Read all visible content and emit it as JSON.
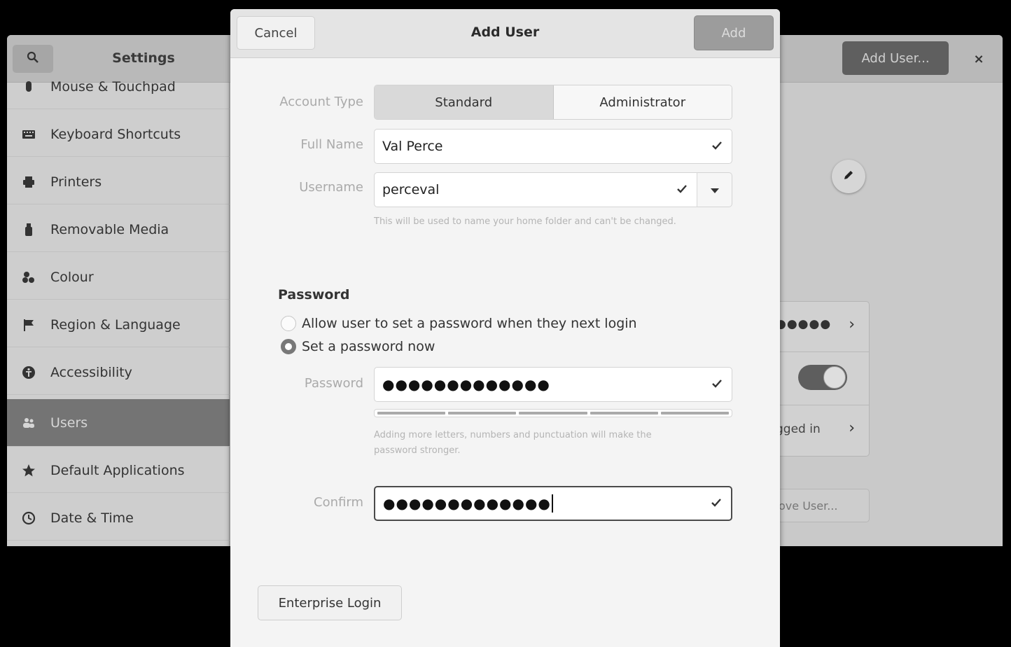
{
  "settings": {
    "title": "Settings",
    "add_user_label": "Add User...",
    "close_label": "×",
    "sidebar": {
      "items": [
        {
          "label": "Mouse & Touchpad",
          "icon": "mouse-icon"
        },
        {
          "label": "Keyboard Shortcuts",
          "icon": "keyboard-icon"
        },
        {
          "label": "Printers",
          "icon": "printer-icon"
        },
        {
          "label": "Removable Media",
          "icon": "usb-icon"
        },
        {
          "label": "Colour",
          "icon": "colour-icon"
        },
        {
          "label": "Region & Language",
          "icon": "flag-icon"
        },
        {
          "label": "Accessibility",
          "icon": "accessibility-icon"
        },
        {
          "label": "Users",
          "icon": "users-icon",
          "active": true
        },
        {
          "label": "Default Applications",
          "icon": "star-icon"
        },
        {
          "label": "Date & Time",
          "icon": "clock-icon"
        }
      ]
    },
    "user_panel": {
      "password_dots": "●●●●●",
      "logged_in_text": "gged in",
      "remove_user_label": "ove User..."
    }
  },
  "dialog": {
    "title": "Add User",
    "cancel_label": "Cancel",
    "add_label": "Add",
    "account_type": {
      "label": "Account Type",
      "options": [
        "Standard",
        "Administrator"
      ],
      "selected": "Standard"
    },
    "full_name": {
      "label": "Full Name",
      "value": "Val Perce"
    },
    "username": {
      "label": "Username",
      "value": "perceval",
      "hint": "This will be used to name your home folder and can't be changed."
    },
    "password_section": {
      "heading": "Password",
      "option_later": "Allow user to set a password when they next login",
      "option_now": "Set a password now",
      "selected": "Set a password now"
    },
    "password": {
      "label": "Password",
      "value": "●●●●●●●●●●●●●",
      "strength": 1.0,
      "hint_line1": "Adding more letters, numbers and punctuation will make the",
      "hint_line2": "password stronger."
    },
    "confirm": {
      "label": "Confirm",
      "value": "●●●●●●●●●●●●●"
    },
    "enterprise_label": "Enterprise Login"
  },
  "colors": {
    "dialog_bg": "#f4f4f4",
    "dim_overlay": "#c9c9c9",
    "active_sidebar": "#747474"
  }
}
